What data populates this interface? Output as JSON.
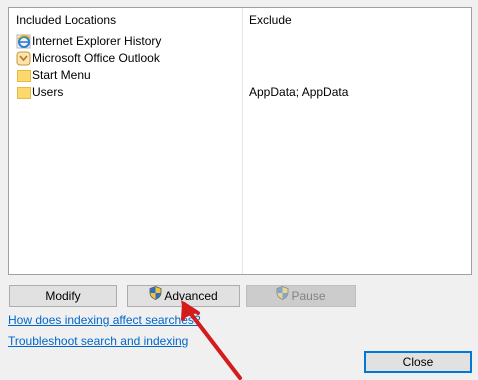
{
  "list": {
    "headers": {
      "included": "Included Locations",
      "exclude": "Exclude"
    },
    "rows": [
      {
        "name": "Internet Explorer History",
        "exclude": "",
        "icon": "ie-icon"
      },
      {
        "name": "Microsoft Office Outlook",
        "exclude": "",
        "icon": "outlook-icon"
      },
      {
        "name": "Start Menu",
        "exclude": "",
        "icon": "folder-icon"
      },
      {
        "name": "Users",
        "exclude": "AppData; AppData",
        "icon": "folder-icon"
      }
    ]
  },
  "buttons": {
    "modify": "Modify",
    "advanced": "Advanced",
    "pause": "Pause",
    "close": "Close"
  },
  "links": {
    "indexing": "How does indexing affect searches?",
    "troubleshoot": "Troubleshoot search and indexing"
  },
  "colors": {
    "link": "#0066cc",
    "annotation_arrow": "#d41c1c",
    "default_button_border": "#0078d7"
  }
}
